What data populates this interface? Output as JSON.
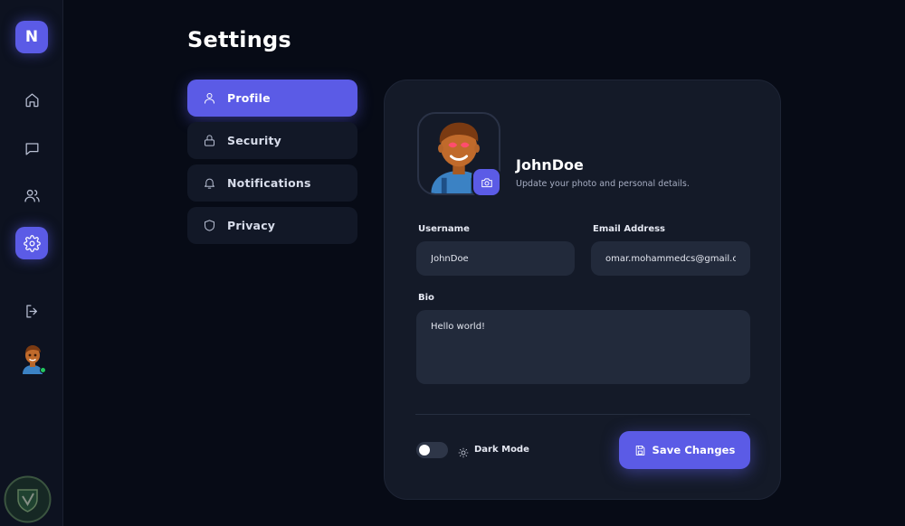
{
  "brand": {
    "logo_letter": "N"
  },
  "sidebar": {
    "icons": [
      "home-icon",
      "chat-icon",
      "users-icon",
      "settings-icon",
      "logout-icon"
    ],
    "active": "settings-icon"
  },
  "page": {
    "title": "Settings"
  },
  "settings_menu": {
    "items": [
      {
        "label": "Profile",
        "icon": "user-icon",
        "active": true
      },
      {
        "label": "Security",
        "icon": "lock-icon",
        "active": false
      },
      {
        "label": "Notifications",
        "icon": "bell-icon",
        "active": false
      },
      {
        "label": "Privacy",
        "icon": "shield-icon",
        "active": false
      }
    ]
  },
  "profile": {
    "name": "JohnDoe",
    "subtitle": "Update your photo and personal details.",
    "username_label": "Username",
    "username_value": "JohnDoe",
    "email_label": "Email Address",
    "email_value": "omar.mohammedcs@gmail.com",
    "bio_label": "Bio",
    "bio_value": "Hello world!"
  },
  "footer": {
    "dark_mode_label": "Dark Mode",
    "dark_mode_on": false,
    "save_label": "Save Changes"
  },
  "colors": {
    "accent": "#5b5be6",
    "background": "#070b16",
    "card": "#141a28",
    "online": "#22c55e"
  }
}
